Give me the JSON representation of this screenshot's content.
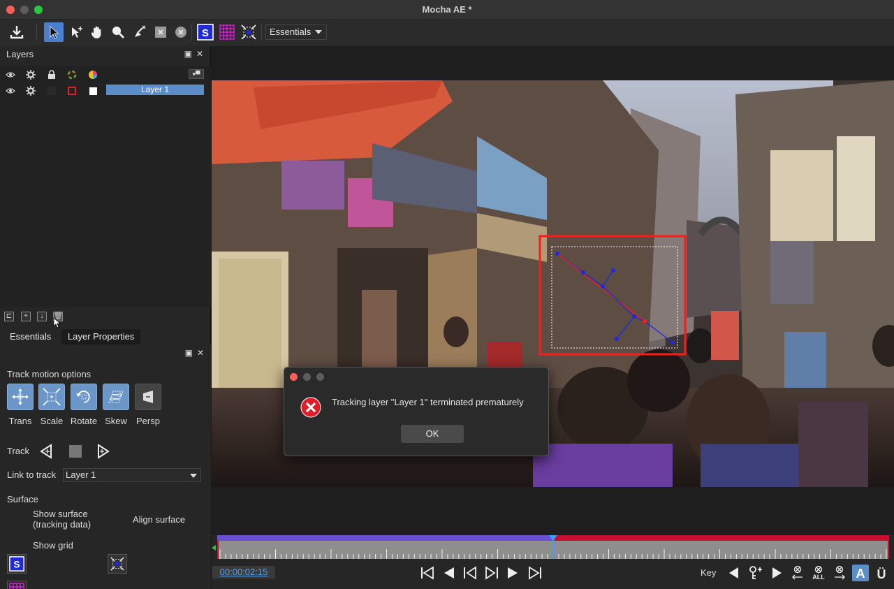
{
  "window": {
    "title": "Mocha AE *"
  },
  "toolbar": {
    "workspace_value": "Essentials",
    "tools": [
      "export-icon",
      "select-arrow-icon",
      "add-point-icon",
      "pan-hand-icon",
      "zoom-icon",
      "pen-icon",
      "x-spline-icon",
      "bezier-icon",
      "surface-toggle-icon",
      "grid-toggle-icon",
      "align-surface-icon"
    ]
  },
  "layers_panel": {
    "title": "Layers",
    "float_icon": "▣",
    "close_icon": "✕",
    "layers": [
      {
        "name": "Layer 1",
        "color": "#dd2222"
      }
    ]
  },
  "tabs": {
    "essentials": "Essentials",
    "layer_properties": "Layer Properties"
  },
  "essentials": {
    "track_motion_label": "Track motion options",
    "motion": [
      {
        "label": "Trans",
        "on": true
      },
      {
        "label": "Scale",
        "on": true
      },
      {
        "label": "Rotate",
        "on": true
      },
      {
        "label": "Skew",
        "on": true
      },
      {
        "label": "Persp",
        "on": false
      }
    ],
    "track_label": "Track",
    "link_label": "Link to track",
    "link_value": "Layer 1",
    "surface_label": "Surface",
    "show_surface_1": "Show surface",
    "show_surface_2": "(tracking data)",
    "align_surface": "Align surface",
    "show_grid": "Show grid"
  },
  "dialog": {
    "message": "Tracking layer \"Layer 1\" terminated prematurely",
    "ok_label": "OK"
  },
  "timeline": {
    "timecode": "00:00:02:15",
    "key_label": "Key",
    "playhead_fraction": 0.5,
    "all_label": "ALL"
  },
  "colors": {
    "accent": "#4a7fd0",
    "layer_red": "#dd2222",
    "timeline_tracked": "#6a4fd6",
    "timeline_untracked": "#c8102e",
    "surface_blue": "#1f2bd8",
    "grid_magenta": "#d71fd7"
  }
}
